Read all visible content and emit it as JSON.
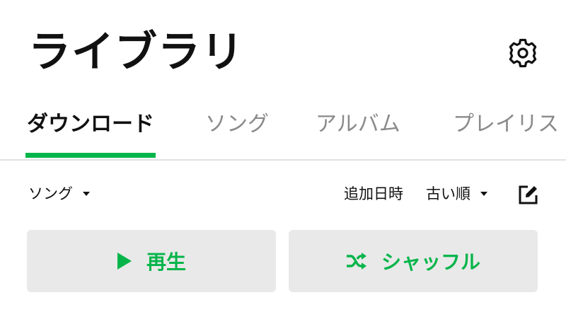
{
  "header": {
    "title": "ライブラリ",
    "settings_icon": "gear-icon"
  },
  "tabs": [
    {
      "label": "ダウンロード",
      "active": true
    },
    {
      "label": "ソング",
      "active": false
    },
    {
      "label": "アルバム",
      "active": false
    },
    {
      "label": "プレイリスト",
      "active": false
    }
  ],
  "filter": {
    "type_label": "ソング",
    "sort_field": "追加日時",
    "sort_order": "古い順",
    "edit_icon": "edit-icon"
  },
  "actions": {
    "play_label": "再生",
    "play_icon": "play-icon",
    "shuffle_label": "シャッフル",
    "shuffle_icon": "shuffle-icon"
  },
  "colors": {
    "accent": "#05b54a",
    "inactive_tab": "#8a8a8a",
    "button_bg": "#e9e9e9",
    "text": "#111111"
  }
}
